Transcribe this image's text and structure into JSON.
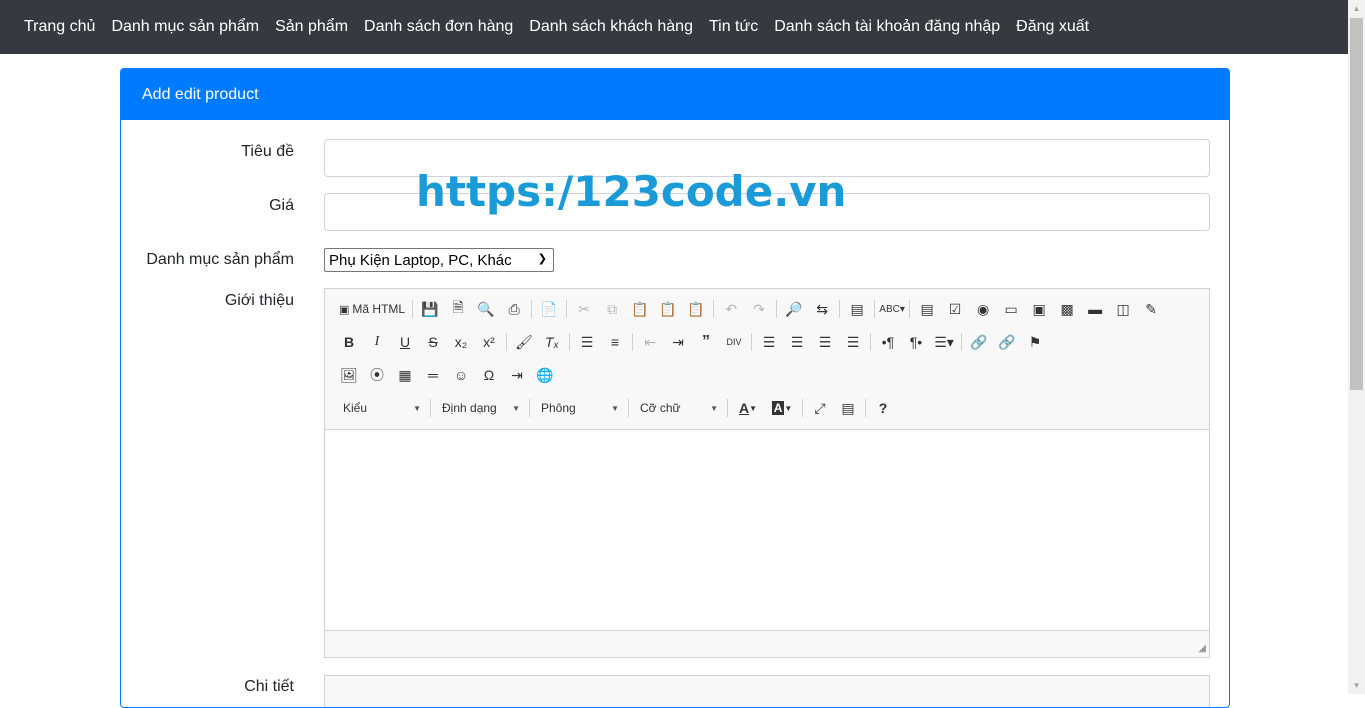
{
  "nav": {
    "items": [
      "Trang chủ",
      "Danh mục sản phẩm",
      "Sản phẩm",
      "Danh sách đơn hàng",
      "Danh sách khách hàng",
      "Tin tức",
      "Danh sách tài khoản đăng nhập",
      "Đăng xuất"
    ]
  },
  "card": {
    "title": "Add edit product"
  },
  "form": {
    "title_label": "Tiêu đề",
    "title_value": "",
    "price_label": "Giá",
    "price_value": "",
    "category_label": "Danh mục sản phẩm",
    "category_selected": "Phụ Kiện Laptop, PC, Khác",
    "intro_label": "Giới thiệu",
    "detail_label": "Chi tiết"
  },
  "watermark": "https:/123code.vn",
  "editor": {
    "source_label": "Mã HTML",
    "combo_style": "Kiểu",
    "combo_format": "Định dạng",
    "combo_font": "Phông",
    "combo_size": "Cỡ chữ",
    "help": "?"
  },
  "colors": {
    "navbar": "#343a40",
    "primary": "#007bff",
    "watermark": "#1a9ad6"
  }
}
